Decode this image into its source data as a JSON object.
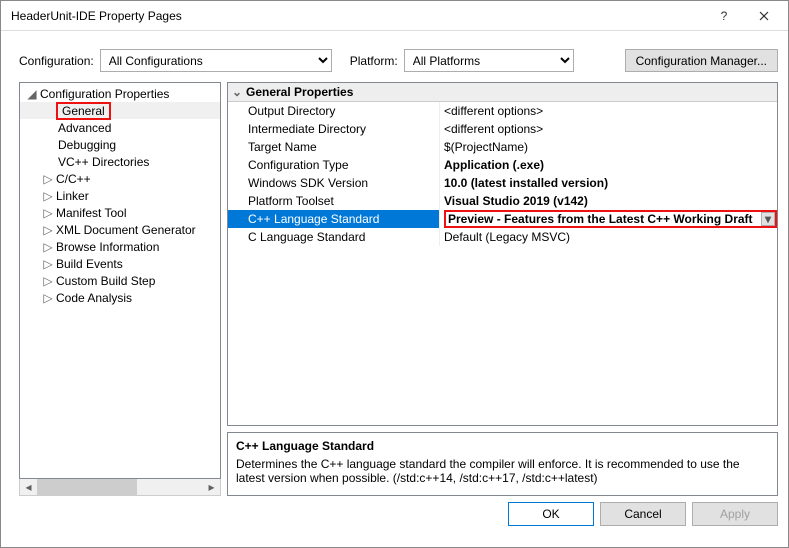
{
  "window": {
    "title": "HeaderUnit-IDE Property Pages"
  },
  "toolbar": {
    "config_label": "Configuration:",
    "config_value": "All Configurations",
    "platform_label": "Platform:",
    "platform_value": "All Platforms",
    "cfgmgr_label": "Configuration Manager..."
  },
  "tree": {
    "root": "Configuration Properties",
    "items": [
      "General",
      "Advanced",
      "Debugging",
      "VC++ Directories",
      "C/C++",
      "Linker",
      "Manifest Tool",
      "XML Document Generator",
      "Browse Information",
      "Build Events",
      "Custom Build Step",
      "Code Analysis"
    ],
    "expandable": [
      "C/C++",
      "Linker",
      "Manifest Tool",
      "XML Document Generator",
      "Browse Information",
      "Build Events",
      "Custom Build Step",
      "Code Analysis"
    ]
  },
  "grid": {
    "header": "General Properties",
    "rows": [
      {
        "name": "Output Directory",
        "value": "<different options>"
      },
      {
        "name": "Intermediate Directory",
        "value": "<different options>"
      },
      {
        "name": "Target Name",
        "value": "$(ProjectName)"
      },
      {
        "name": "Configuration Type",
        "value": "Application (.exe)",
        "bold": true
      },
      {
        "name": "Windows SDK Version",
        "value": "10.0 (latest installed version)",
        "bold": true
      },
      {
        "name": "Platform Toolset",
        "value": "Visual Studio 2019 (v142)",
        "bold": true
      },
      {
        "name": "C++ Language Standard",
        "value": "Preview - Features from the Latest C++ Working Draft",
        "bold": true,
        "selected": true,
        "highlight": true
      },
      {
        "name": "C Language Standard",
        "value": "Default (Legacy MSVC)"
      }
    ]
  },
  "desc": {
    "title": "C++ Language Standard",
    "body": "Determines the C++ language standard the compiler will enforce. It is recommended to use the latest version when possible.  (/std:c++14, /std:c++17, /std:c++latest)"
  },
  "buttons": {
    "ok": "OK",
    "cancel": "Cancel",
    "apply": "Apply"
  }
}
